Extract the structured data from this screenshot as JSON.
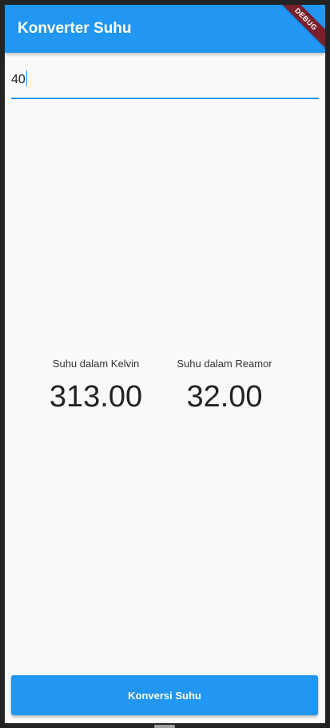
{
  "app": {
    "title": "Konverter Suhu",
    "debug_banner": "DEBUG"
  },
  "input": {
    "value": "40"
  },
  "results": {
    "kelvin": {
      "label": "Suhu dalam Kelvin",
      "value": "313.00"
    },
    "reamor": {
      "label": "Suhu dalam Reamor",
      "value": "32.00"
    }
  },
  "actions": {
    "convert_label": "Konversi Suhu"
  },
  "colors": {
    "primary": "#2196f3",
    "background": "#fafafa",
    "debug_banner": "#7a1f2b"
  }
}
